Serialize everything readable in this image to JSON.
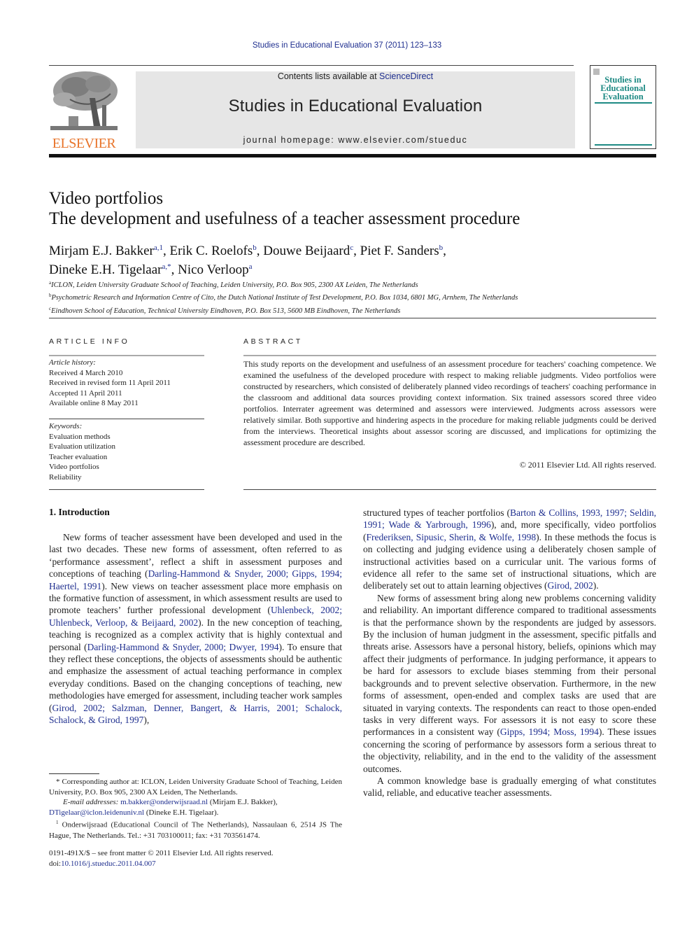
{
  "running_header": "Studies in Educational Evaluation 37 (2011) 123–133",
  "publisher": {
    "logo_text": "ELSEVIER",
    "logo_icon": "elsevier-tree-icon",
    "brand_color": "#e8742a"
  },
  "journal_box": {
    "contents_prefix": "Contents lists available at ",
    "contents_link": "ScienceDirect",
    "journal_title": "Studies in Educational Evaluation",
    "homepage": "journal homepage: www.elsevier.com/stueduc"
  },
  "cover": {
    "title_lines": [
      "Studies in",
      "Educational",
      "Evaluation"
    ],
    "accent_color": "#1e8a84"
  },
  "article": {
    "title_line1": "Video portfolios",
    "title_line2": "The development and usefulness of a teacher assessment procedure",
    "authors_line1": [
      {
        "name": "Mirjam E.J. Bakker",
        "sup": "a,1",
        "sep": ", "
      },
      {
        "name": "Erik C. Roelofs",
        "sup": "b",
        "sep": ", "
      },
      {
        "name": "Douwe Beijaard",
        "sup": "c",
        "sep": ", "
      },
      {
        "name": "Piet F. Sanders",
        "sup": "b",
        "sep": ","
      }
    ],
    "authors_line2": [
      {
        "name": "Dineke E.H. Tigelaar",
        "sup": "a,*",
        "sep": ", "
      },
      {
        "name": "Nico Verloop",
        "sup": "a",
        "sep": ""
      }
    ],
    "affiliations": [
      {
        "key": "a",
        "text": "ICLON, Leiden University Graduate School of Teaching, Leiden University, P.O. Box 905, 2300 AX Leiden, The Netherlands"
      },
      {
        "key": "b",
        "text": "Psychometric Research and Information Centre of Cito, the Dutch National Institute of Test Development, P.O. Box 1034, 6801 MG, Arnhem, The Netherlands"
      },
      {
        "key": "c",
        "text": "Eindhoven School of Education, Technical University Eindhoven, P.O. Box 513, 5600 MB Eindhoven, The Netherlands"
      }
    ]
  },
  "article_info": {
    "heading": "ARTICLE INFO",
    "history_label": "Article history:",
    "history": [
      "Received 4 March 2010",
      "Received in revised form 11 April 2011",
      "Accepted 11 April 2011",
      "Available online 8 May 2011"
    ],
    "keywords_label": "Keywords:",
    "keywords": [
      "Evaluation methods",
      "Evaluation utilization",
      "Teacher evaluation",
      "Video portfolios",
      "Reliability"
    ]
  },
  "abstract": {
    "heading": "ABSTRACT",
    "text": "This study reports on the development and usefulness of an assessment procedure for teachers' coaching competence. We examined the usefulness of the developed procedure with respect to making reliable judgments. Video portfolios were constructed by researchers, which consisted of deliberately planned video recordings of teachers' coaching performance in the classroom and additional data sources providing context information. Six trained assessors scored three video portfolios. Interrater agreement was determined and assessors were interviewed. Judgments across assessors were relatively similar. Both supportive and hindering aspects in the procedure for making reliable judgments could be derived from the interviews. Theoretical insights about assessor scoring are discussed, and implications for optimizing the assessment procedure are described.",
    "copyright": "© 2011 Elsevier Ltd. All rights reserved."
  },
  "introduction": {
    "heading": "1.  Introduction",
    "left_column": [
      {
        "t": "New forms of teacher assessment have been developed and used in the last two decades. These new forms of assessment, often referred to as ‘performance assessment’, reflect a shift in assessment purposes and conceptions of teaching ("
      },
      {
        "link": "Darling-Hammond & Snyder, 2000; Gipps, 1994; Haertel, 1991"
      },
      {
        "t": "). New views on teacher assessment place more emphasis on the formative function of assessment, in which assessment results are used to promote teachers’ further professional development ("
      },
      {
        "link": "Uhlenbeck, 2002; Uhlenbeck, Verloop, & Beijaard, 2002"
      },
      {
        "t": "). In the new conception of teaching, teaching is recognized as a complex activity that is highly contextual and personal ("
      },
      {
        "link": "Darling-Hammond & Snyder, 2000; Dwyer, 1994"
      },
      {
        "t": "). To ensure that they reflect these conceptions, the objects of assessments should be authentic and emphasize the assessment of actual teaching performance in complex everyday conditions. Based on the changing conceptions of teaching, new methodologies have emerged for assessment, including teacher work samples ("
      },
      {
        "link": "Girod, 2002; Salzman, Denner, Bangert, & Harris, 2001; Schalock, Schalock, & Girod, 1997"
      },
      {
        "t": "),"
      }
    ],
    "right_para1": [
      {
        "t": "structured types of teacher portfolios ("
      },
      {
        "link": "Barton & Collins, 1993, 1997; Seldin, 1991; Wade & Yarbrough, 1996"
      },
      {
        "t": "), and, more specifically, video portfolios ("
      },
      {
        "link": "Frederiksen, Sipusic, Sherin, & Wolfe, 1998"
      },
      {
        "t": "). In these methods the focus is on collecting and judging evidence using a deliberately chosen sample of instructional activities based on a curricular unit. The various forms of evidence all refer to the same set of instructional situations, which are deliberately set out to attain learning objectives ("
      },
      {
        "link": "Girod, 2002"
      },
      {
        "t": ")."
      }
    ],
    "right_para2": [
      {
        "t": "New forms of assessment bring along new problems concerning validity and reliability. An important difference compared to traditional assessments is that the performance shown by the respondents are judged by assessors. By the inclusion of human judgment in the assessment, specific pitfalls and threats arise. Assessors have a personal history, beliefs, opinions which may affect their judgments of performance. In judging performance, it appears to be hard for assessors to exclude biases stemming from their personal backgrounds and to prevent selective observation. Furthermore, in the new forms of assessment, open-ended and complex tasks are used that are situated in varying contexts. The respondents can react to those open-ended tasks in very different ways. For assessors it is not easy to score these performances in a consistent way ("
      },
      {
        "link": "Gipps, 1994; Moss, 1994"
      },
      {
        "t": "). These issues concerning the scoring of performance by assessors form a serious threat to the objectivity, reliability, and in the end to the validity of the assessment outcomes."
      }
    ],
    "right_para3": "A common knowledge base is gradually emerging of what constitutes valid, reliable, and educative teacher assessments."
  },
  "footnotes": {
    "corresponding": "* Corresponding author at: ICLON, Leiden University Graduate School of Teaching, Leiden University, P.O. Box 905, 2300 AX Leiden, The Netherlands.",
    "email_label": "E-mail addresses: ",
    "email1": "m.bakker@onderwijsraad.nl",
    "email1_owner": " (Mirjam E.J. Bakker),",
    "email2": "DTigelaar@iclon.leidenuniv.nl",
    "email2_owner": " (Dineke E.H. Tigelaar).",
    "note1_marker": "1",
    "note1": " Onderwijsraad (Educational Council of The Netherlands), Nassaulaan 6, 2514 JS The Hague, The Netherlands. Tel.: +31 703100011; fax: +31 703561474.",
    "issn": "0191-491X/$ – see front matter © 2011 Elsevier Ltd. All rights reserved.",
    "doi_label": "doi:",
    "doi": "10.1016/j.stueduc.2011.04.007"
  },
  "colors": {
    "link": "#1f2f8f",
    "text": "#222222"
  }
}
